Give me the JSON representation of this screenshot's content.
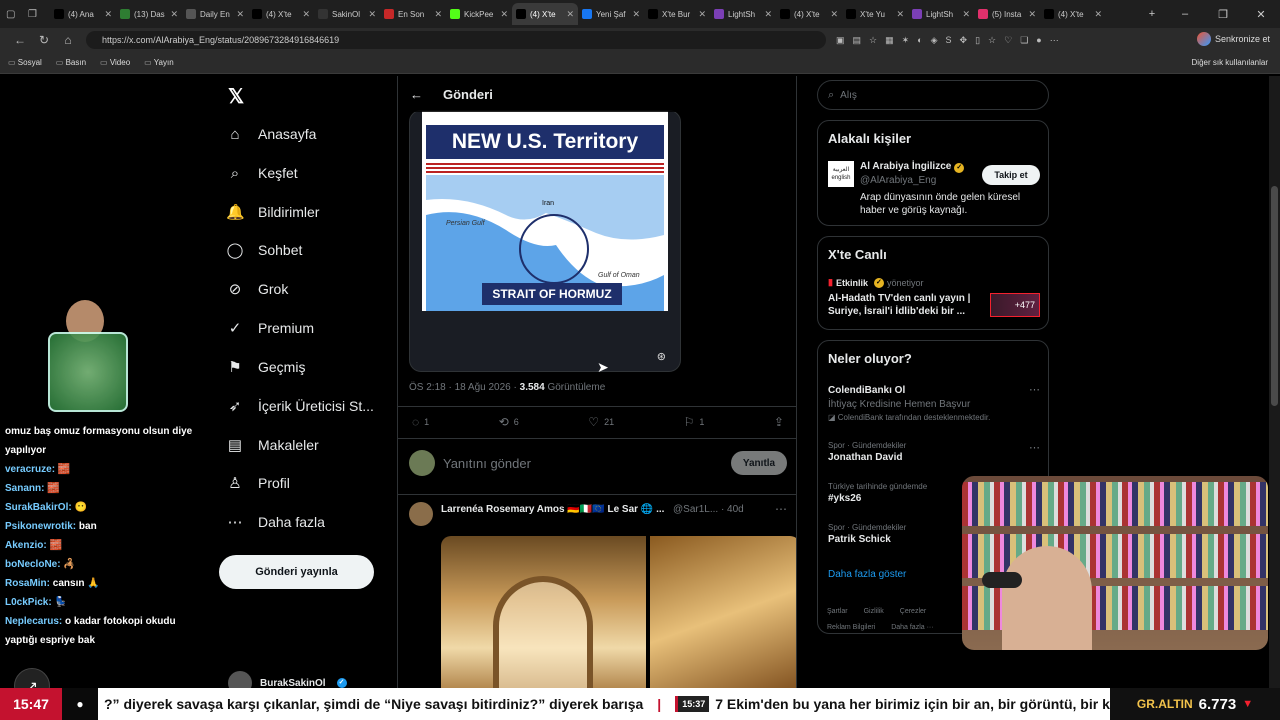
{
  "browser": {
    "tabs": [
      {
        "label": "(4) Ana",
        "color": "#000"
      },
      {
        "label": "(13) Das",
        "color": "#2e7d32"
      },
      {
        "label": "Daily En",
        "color": "#555"
      },
      {
        "label": "(4) X'te",
        "color": "#000"
      },
      {
        "label": "SakinOl",
        "color": "#333"
      },
      {
        "label": "En Son",
        "color": "#c62828"
      },
      {
        "label": "KickPee",
        "color": "#53fc18"
      },
      {
        "label": "(4) X'te",
        "color": "#000",
        "active": true
      },
      {
        "label": "Yeni Şaf",
        "color": "#1877f2"
      },
      {
        "label": "X'te Bur",
        "color": "#000"
      },
      {
        "label": "LightSh",
        "color": "#7b3fb5"
      },
      {
        "label": "(4) X'te",
        "color": "#000"
      },
      {
        "label": "X'te Yu",
        "color": "#000"
      },
      {
        "label": "LightSh",
        "color": "#7b3fb5"
      },
      {
        "label": "(5) Insta",
        "color": "#e1306c"
      },
      {
        "label": "(4) X'te",
        "color": "#000"
      }
    ],
    "url": "https://x.com/AlArabiya_Eng/status/2089673284916846619",
    "sync_label": "Senkronize et",
    "bookmarks": [
      "Sosyal",
      "Basın",
      "Video",
      "Yayın"
    ],
    "other_bookmarks": "Diğer sık kullanılanlar"
  },
  "nav": {
    "items": [
      {
        "label": "Anasayfa",
        "icon": "⌂",
        "name": "home"
      },
      {
        "label": "Keşfet",
        "icon": "⌕",
        "name": "explore"
      },
      {
        "label": "Bildirimler",
        "icon": "🔔",
        "name": "notifications"
      },
      {
        "label": "Sohbet",
        "icon": "◯",
        "name": "chat"
      },
      {
        "label": "Grok",
        "icon": "⊘",
        "name": "grok"
      },
      {
        "label": "Premium",
        "icon": "✓",
        "name": "premium"
      },
      {
        "label": "Geçmiş",
        "icon": "⚑",
        "name": "bookmarks"
      },
      {
        "label": "İçerik Üreticisi St...",
        "icon": "➶",
        "name": "creator-studio"
      },
      {
        "label": "Makaleler",
        "icon": "▤",
        "name": "articles"
      },
      {
        "label": "Profil",
        "icon": "♙",
        "name": "profile"
      },
      {
        "label": "Daha fazla",
        "icon": "⋯",
        "name": "more"
      }
    ],
    "post_button": "Gönderi yayınla",
    "account_name": "BurakSakinOl"
  },
  "post": {
    "header": "Gönderi",
    "image_title": "NEW U.S. Territory",
    "map_labels": {
      "iran": "Iran",
      "persian": "Persian Gulf",
      "oman": "Gulf of Oman"
    },
    "strait_label": "STRAIT OF HORMUZ",
    "time": "ÖS 2:18 · 18 Ağu 2026 ·",
    "views": "3.584",
    "views_label": "Görüntüleme",
    "replies": "1",
    "reposts": "6",
    "likes": "21",
    "bookmarks": "1",
    "reply_placeholder": "Yanıtını gönder",
    "reply_button": "Yanıtla"
  },
  "post2": {
    "name": "Larrenéa Rosemary Amos 🇩🇪🇮🇹🇪🇺 Le Sar 🌐 ...",
    "handle": "@Sar1L... · 40d"
  },
  "sidebar": {
    "search_placeholder": "Alış",
    "people_title": "Alakalı kişiler",
    "person": {
      "name": "Al Arabiya İngilizce",
      "handle": "@AlArabiya_Eng",
      "bio": "Arap dünyasının önde gelen küresel haber ve görüş kaynağı.",
      "follow": "Takip et",
      "logo": "العربية english"
    },
    "live_title": "X'te Canlı",
    "live": {
      "event": "Etkinlik",
      "role": "yönetiyor",
      "title": "Al-Hadath TV'den canlı yayın | Suriye, İsrail'i İdlib'deki bir ...",
      "count": "+477"
    },
    "trends_title": "Neler oluyor?",
    "trends": [
      {
        "category": "",
        "name": "ColendiBankı Ol",
        "sub": "İhtiyaç Kredisine Hemen Başvur",
        "promo": "ColendiBank tarafından desteklenmektedir."
      },
      {
        "category": "Spor · Gündemdekiler",
        "name": "Jonathan David",
        "sub": "",
        "promo": ""
      },
      {
        "category": "Türkiye tarihinde gündemde",
        "name": "#yks26",
        "sub": "",
        "promo": ""
      },
      {
        "category": "Spor · Gündemdekiler",
        "name": "Patrik Schick",
        "sub": "",
        "promo": ""
      }
    ],
    "show_more": "Daha fazla göster",
    "footer": [
      "Şartlar",
      "Gizlilik",
      "Çerezler",
      "Reklam Bilgileri",
      "Daha fazla ···"
    ]
  },
  "chat": [
    {
      "user": "",
      "msg": "omuz baş omuz formasyonu olsun diye yapılıyor"
    },
    {
      "user": "veracruze:",
      "msg": "🧱"
    },
    {
      "user": "Sanann:",
      "msg": "🧱"
    },
    {
      "user": "SurakBakirOl:",
      "msg": "😶"
    },
    {
      "user": "Psikonewrotik:",
      "msg": "ban"
    },
    {
      "user": "Akenzio:",
      "msg": "🧱"
    },
    {
      "user": "boNecloNe:",
      "msg": "🦂"
    },
    {
      "user": "RosaMin:",
      "msg": "cansın 🙏"
    },
    {
      "user": "L0ckPick:",
      "msg": "💺"
    },
    {
      "user": "Neplecarus:",
      "msg": "o kadar fotokopi okudu yaptığı espriye bak"
    }
  ],
  "ticker": {
    "clock": "15:47",
    "text1": "?” diyerek savaşa karşı çıkanlar, şimdi de “Niye savaşı bitirdiniz?” diyerek barışa",
    "time2": "15:37",
    "text2": "7 Ekim'den bu yana her birimiz için bir an, bir görüntü, bir kişi yür",
    "gold_label": "GR.ALTIN",
    "gold_value": "6.773"
  }
}
